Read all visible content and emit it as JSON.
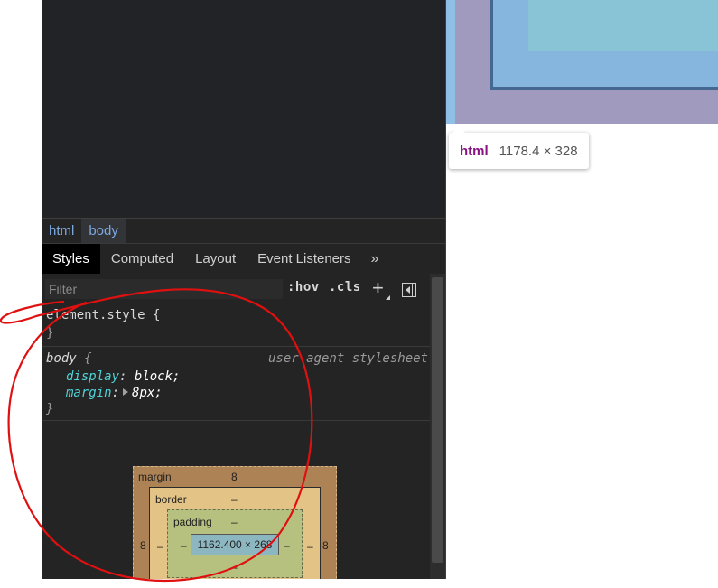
{
  "breadcrumbs": [
    "html",
    "body"
  ],
  "tabs": {
    "styles": "Styles",
    "computed": "Computed",
    "layout": "Layout",
    "event_listeners": "Event Listeners",
    "more": "»"
  },
  "filter": {
    "placeholder": "Filter",
    "hov": ":hov",
    "cls": ".cls",
    "plus": "+"
  },
  "rules": {
    "element_style": {
      "selector": "element.style {",
      "close": "}"
    },
    "body": {
      "selector": "body",
      "open": "{",
      "origin": "user agent stylesheet",
      "decl1_prop": "display",
      "decl1_val": "block;",
      "decl2_prop": "margin",
      "decl2_val": "8px;",
      "colon": ":",
      "close": "}"
    }
  },
  "box_model": {
    "margin_label": "margin",
    "margin_top": "8",
    "margin_left": "8",
    "margin_right": "8",
    "border_label": "border",
    "border_top": "–",
    "border_left": "–",
    "border_right": "–",
    "padding_label": "padding",
    "padding_top": "–",
    "padding_left": "–",
    "padding_right": "–",
    "padding_bottom": "–",
    "content": "1162.400 × 268"
  },
  "tooltip": {
    "tag": "html",
    "size": "1178.4 × 328"
  },
  "colors": {
    "annotation": "#e01010",
    "property": "#4ed2d6",
    "tag_purple": "#881280",
    "crumb_blue": "#7ca8e0"
  }
}
